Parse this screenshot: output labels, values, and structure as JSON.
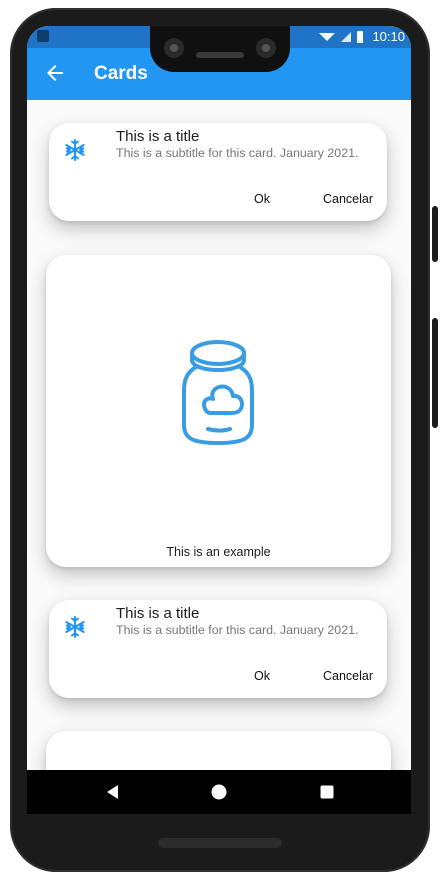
{
  "status": {
    "time": "10:10"
  },
  "appbar": {
    "title": "Cards"
  },
  "cards": [
    {
      "type": "list-card",
      "title": "This is a title",
      "subtitle": "This is a subtitle for this card. January 2021.",
      "actions": {
        "ok": "Ok",
        "cancel": "Cancelar"
      },
      "icon": "snowflake-icon"
    },
    {
      "type": "image-card",
      "caption": "This is an example",
      "icon": "jar-icon"
    },
    {
      "type": "list-card",
      "title": "This is a title",
      "subtitle": "This is a subtitle for this card. January 2021.",
      "actions": {
        "ok": "Ok",
        "cancel": "Cancelar"
      },
      "icon": "snowflake-icon"
    }
  ],
  "colors": {
    "primary": "#2196f3",
    "status_bar": "#1f74c8",
    "accent_icon": "#2196f3"
  },
  "nav": {
    "back": "back-triangle-icon",
    "home": "home-circle-icon",
    "recent": "recent-square-icon"
  }
}
